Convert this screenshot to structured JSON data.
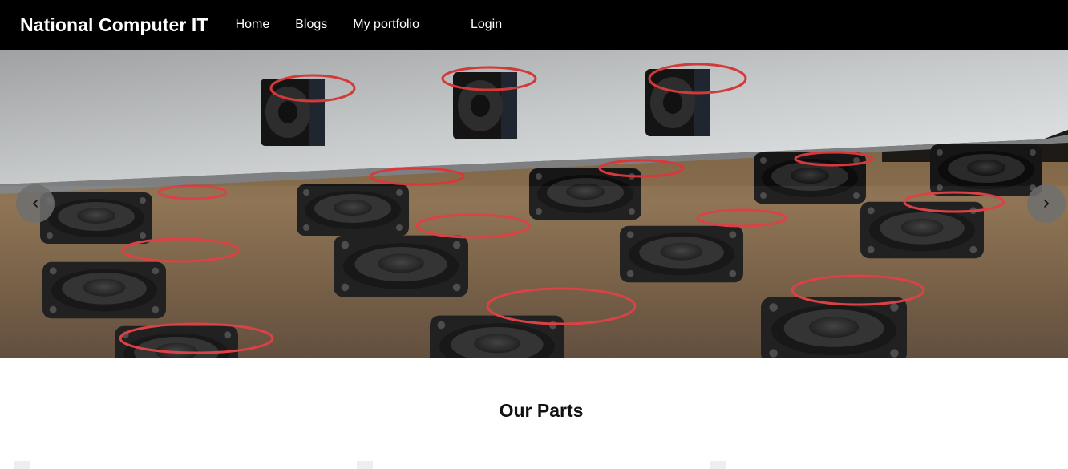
{
  "navbar": {
    "brand": "National Computer IT",
    "links": [
      "Home",
      "Blogs",
      "My portfolio"
    ],
    "login": "Login"
  },
  "carousel": {
    "prev_symbol": "‹",
    "next_symbol": "›",
    "image_icon": "cooling-fans-photo"
  },
  "section": {
    "title": "Our Parts"
  },
  "colors": {
    "navbar_bg": "#000000",
    "nav_text": "#ffffff",
    "control_bg": "#6e6e6e"
  }
}
